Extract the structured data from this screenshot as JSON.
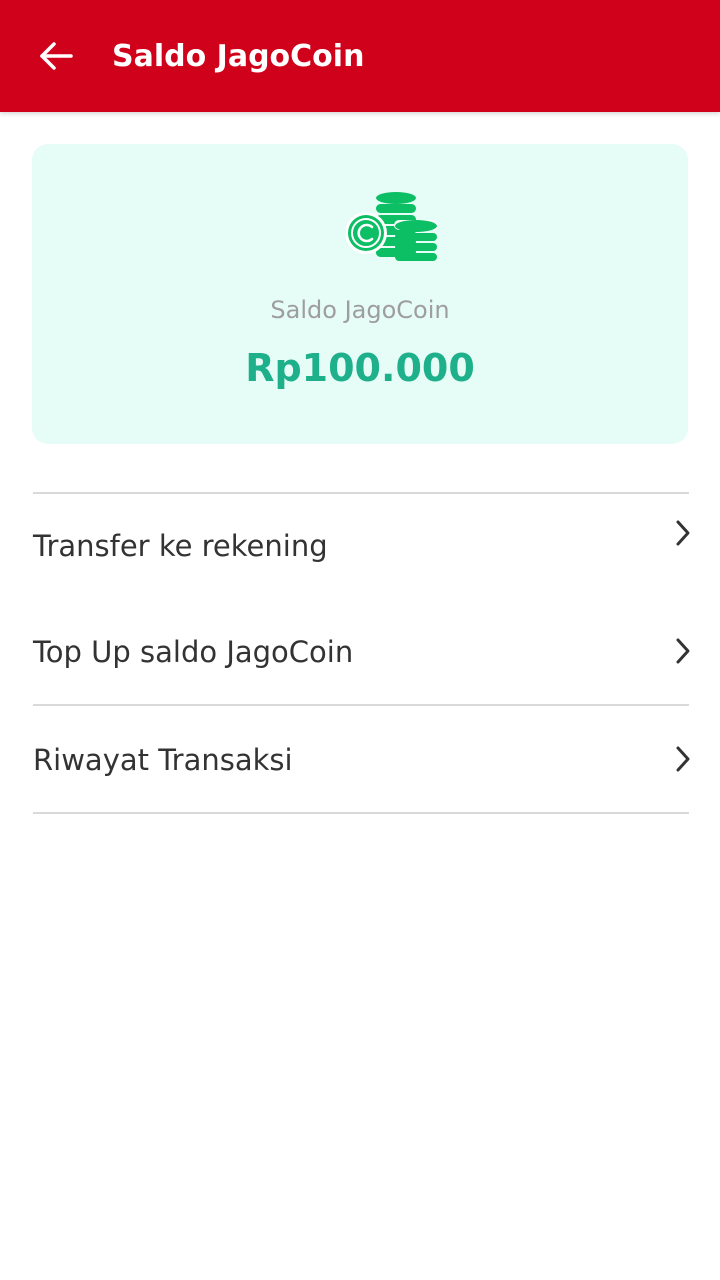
{
  "app_bar": {
    "title": "Saldo JagoCoin",
    "back_icon": "arrow-left-icon",
    "background_color": "#D0021B"
  },
  "balance_card": {
    "icon": "coins-stack-icon",
    "label": "Saldo JagoCoin",
    "amount": "Rp100.000",
    "background_color": "#E6FCF6",
    "amount_color": "#1DB08A",
    "icon_color": "#0CBE64"
  },
  "menu": {
    "items": [
      {
        "label": "Transfer ke rekening",
        "icon": "chevron-right-icon"
      },
      {
        "label": "Top Up saldo JagoCoin",
        "icon": "chevron-right-icon"
      },
      {
        "label": "Riwayat Transaksi",
        "icon": "chevron-right-icon"
      }
    ]
  }
}
